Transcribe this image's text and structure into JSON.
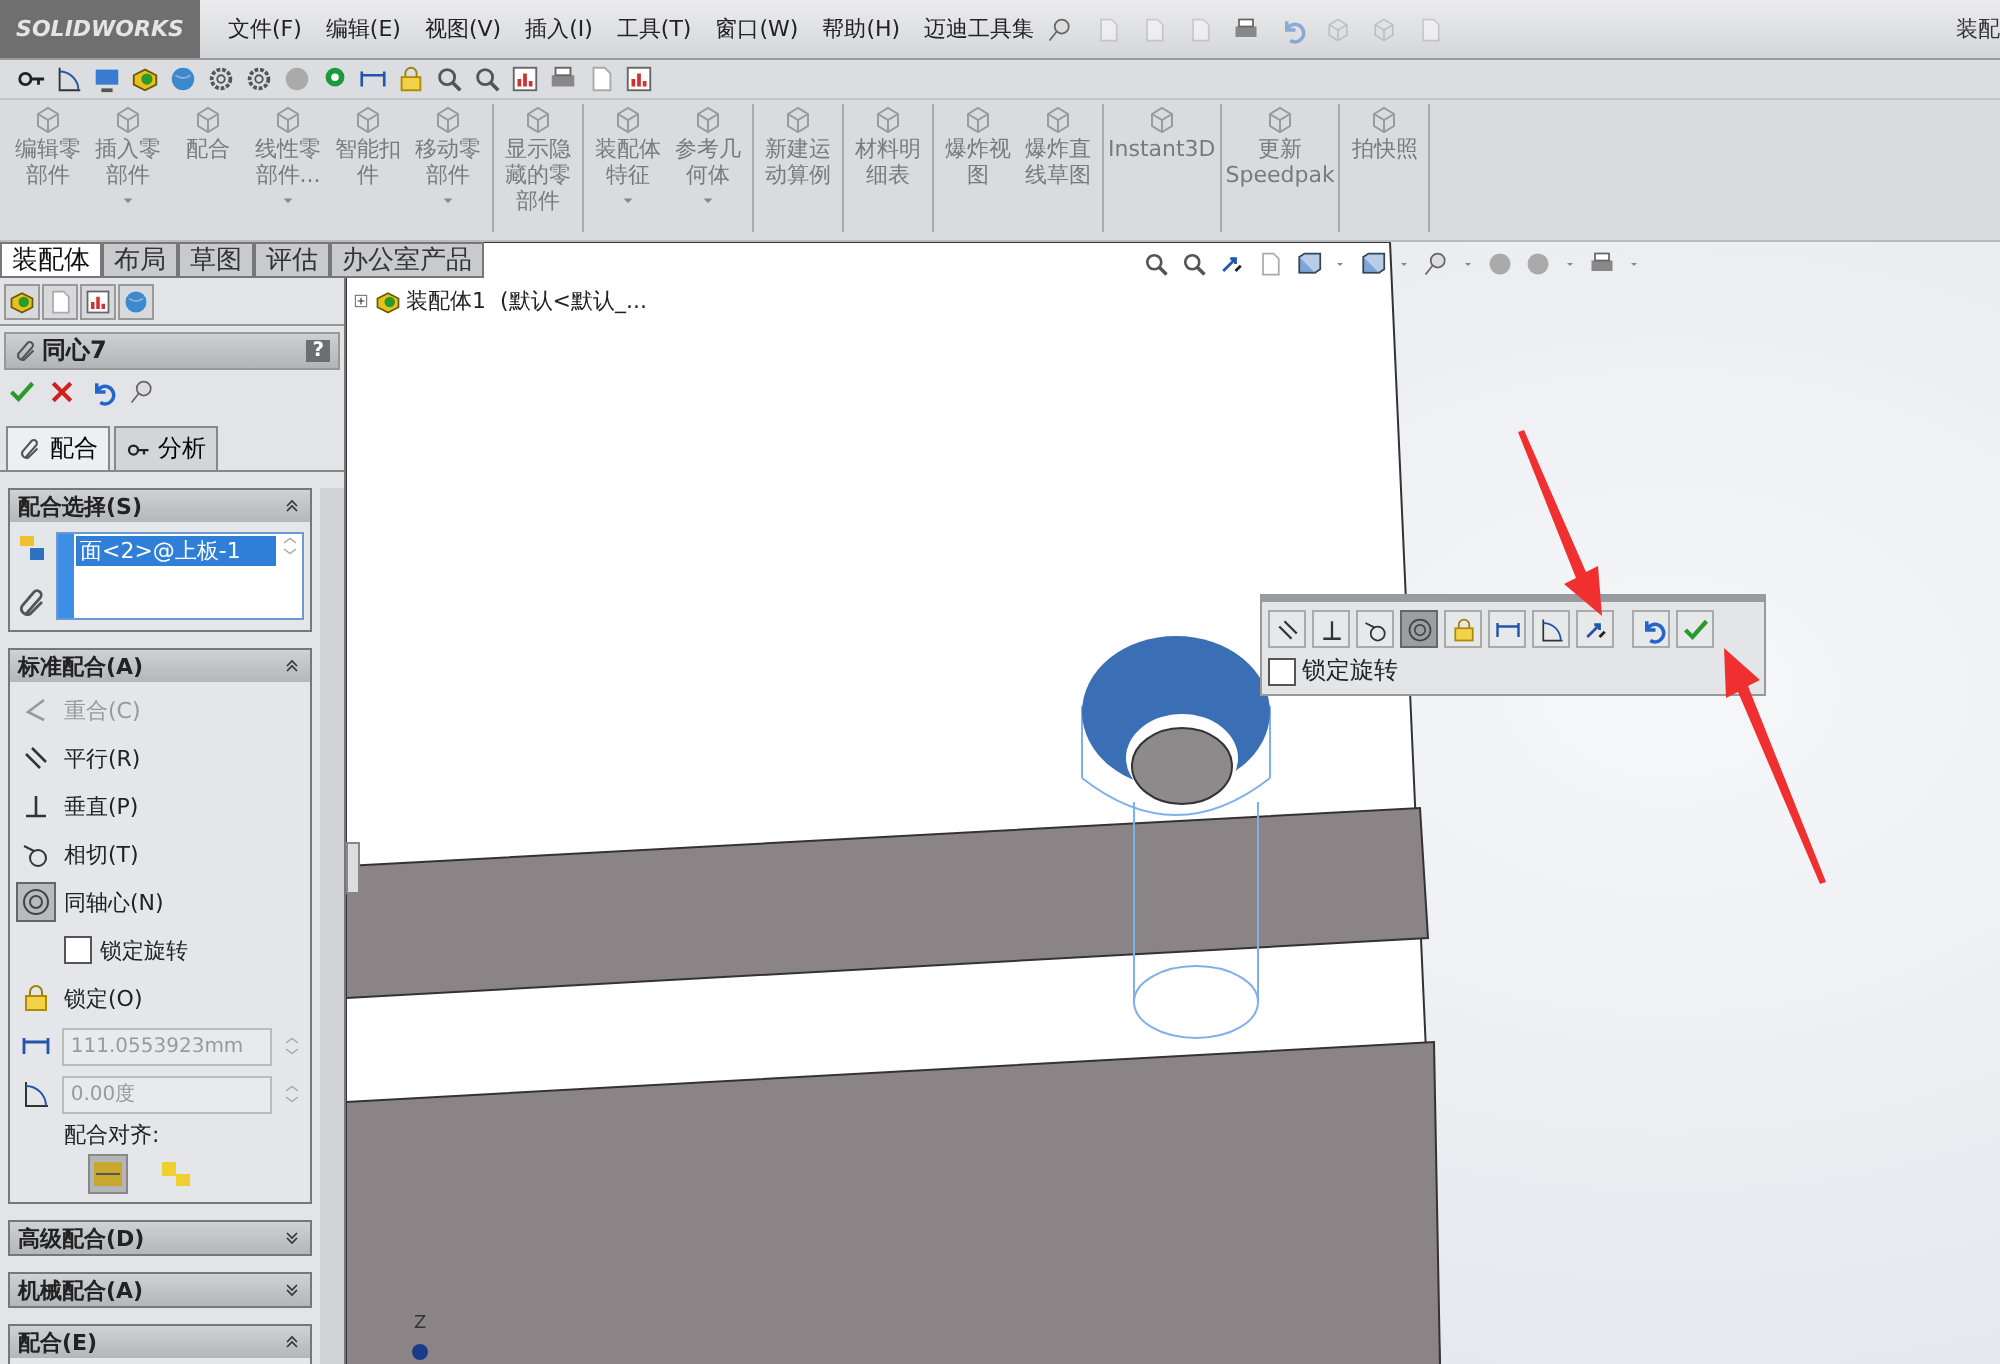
{
  "app_bar": {
    "logo": "SOLIDWORKS",
    "menu": [
      {
        "label": "文件(F)"
      },
      {
        "label": "编辑(E)"
      },
      {
        "label": "视图(V)"
      },
      {
        "label": "插入(I)"
      },
      {
        "label": "工具(T)"
      },
      {
        "label": "窗口(W)"
      },
      {
        "label": "帮助(H)"
      },
      {
        "label": "迈迪工具集"
      }
    ],
    "title": "装配"
  },
  "command_manager": {
    "groups": [
      [
        {
          "label": "编辑零部件",
          "dropdown": false
        },
        {
          "label": "插入零部件",
          "dropdown": true
        },
        {
          "label": "配合",
          "dropdown": false
        },
        {
          "label": "线性零部件...",
          "dropdown": true
        },
        {
          "label": "智能扣件",
          "dropdown": false
        },
        {
          "label": "移动零部件",
          "dropdown": true
        }
      ],
      [
        {
          "label": "显示隐藏的零部件",
          "dropdown": false
        }
      ],
      [
        {
          "label": "装配体特征",
          "dropdown": true
        },
        {
          "label": "参考几何体",
          "dropdown": true
        }
      ],
      [
        {
          "label": "新建运动算例",
          "dropdown": false
        }
      ],
      [
        {
          "label": "材料明细表",
          "dropdown": false
        }
      ],
      [
        {
          "label": "爆炸视图",
          "dropdown": false
        },
        {
          "label": "爆炸直线草图",
          "dropdown": false
        }
      ],
      [
        {
          "label": "Instant3D",
          "dropdown": false
        }
      ],
      [
        {
          "label": "更新 Speedpak",
          "dropdown": false
        }
      ],
      [
        {
          "label": "拍快照",
          "dropdown": false
        }
      ]
    ]
  },
  "tabs": [
    {
      "label": "装配体",
      "selected": true
    },
    {
      "label": "布局",
      "selected": false
    },
    {
      "label": "草图",
      "selected": false
    },
    {
      "label": "评估",
      "selected": false
    },
    {
      "label": "办公室产品",
      "selected": false
    }
  ],
  "property_manager": {
    "title": "同心7",
    "help": "?",
    "tabs": [
      {
        "label": "配合",
        "selected": true
      },
      {
        "label": "分析",
        "selected": false
      }
    ],
    "sections": [
      {
        "kind": "selection",
        "title": "配合选择(S)",
        "expanded": true,
        "entries": [
          {
            "label": "面<2>@上板-1",
            "selected": true
          }
        ]
      },
      {
        "kind": "mates",
        "title": "标准配合(A)",
        "expanded": true,
        "rows": [
          {
            "kind": "coincident",
            "label": "重合(C)",
            "disabled": true,
            "selected": false
          },
          {
            "kind": "parallel",
            "label": "平行(R)",
            "disabled": false,
            "selected": false
          },
          {
            "kind": "perpendicular",
            "label": "垂直(P)",
            "disabled": false,
            "selected": false
          },
          {
            "kind": "tangent",
            "label": "相切(T)",
            "disabled": false,
            "selected": false
          },
          {
            "kind": "concentric",
            "label": "同轴心(N)",
            "disabled": false,
            "selected": true
          },
          {
            "kind": "checkbox",
            "label": "锁定旋转",
            "checked": false
          },
          {
            "kind": "lock",
            "label": "锁定(O)",
            "disabled": false,
            "selected": false
          },
          {
            "kind": "distance",
            "value": "111.0553923mm",
            "disabled": true
          },
          {
            "kind": "angle",
            "value": "0.00度",
            "disabled": true
          },
          {
            "kind": "caption",
            "label": "配合对齐:"
          },
          {
            "kind": "alignment",
            "options": [
              {
                "selected": true
              },
              {
                "selected": false
              }
            ]
          }
        ]
      },
      {
        "kind": "header",
        "title": "高级配合(D)",
        "expanded": false
      },
      {
        "kind": "header",
        "title": "机械配合(A)",
        "expanded": false
      },
      {
        "kind": "list",
        "title": "配合(E)",
        "expanded": true
      }
    ]
  },
  "graphics": {
    "tree_item": {
      "label": "装配体1  (默认<默认_...",
      "expanded": false
    },
    "mate_toolbar": {
      "buttons": [
        {
          "kind": "parallel",
          "selected": false
        },
        {
          "kind": "perpendicular",
          "selected": false
        },
        {
          "kind": "tangent",
          "selected": false
        },
        {
          "kind": "concentric",
          "selected": true
        },
        {
          "kind": "lock",
          "selected": false
        },
        {
          "kind": "distance",
          "selected": false
        },
        {
          "kind": "angle",
          "selected": false
        },
        {
          "kind": "flip",
          "selected": false
        },
        {
          "kind": "undo",
          "selected": false
        },
        {
          "kind": "ok",
          "selected": false
        }
      ],
      "lock_rotation": {
        "label": "锁定旋转",
        "checked": false
      }
    },
    "triad_label": "Z"
  }
}
